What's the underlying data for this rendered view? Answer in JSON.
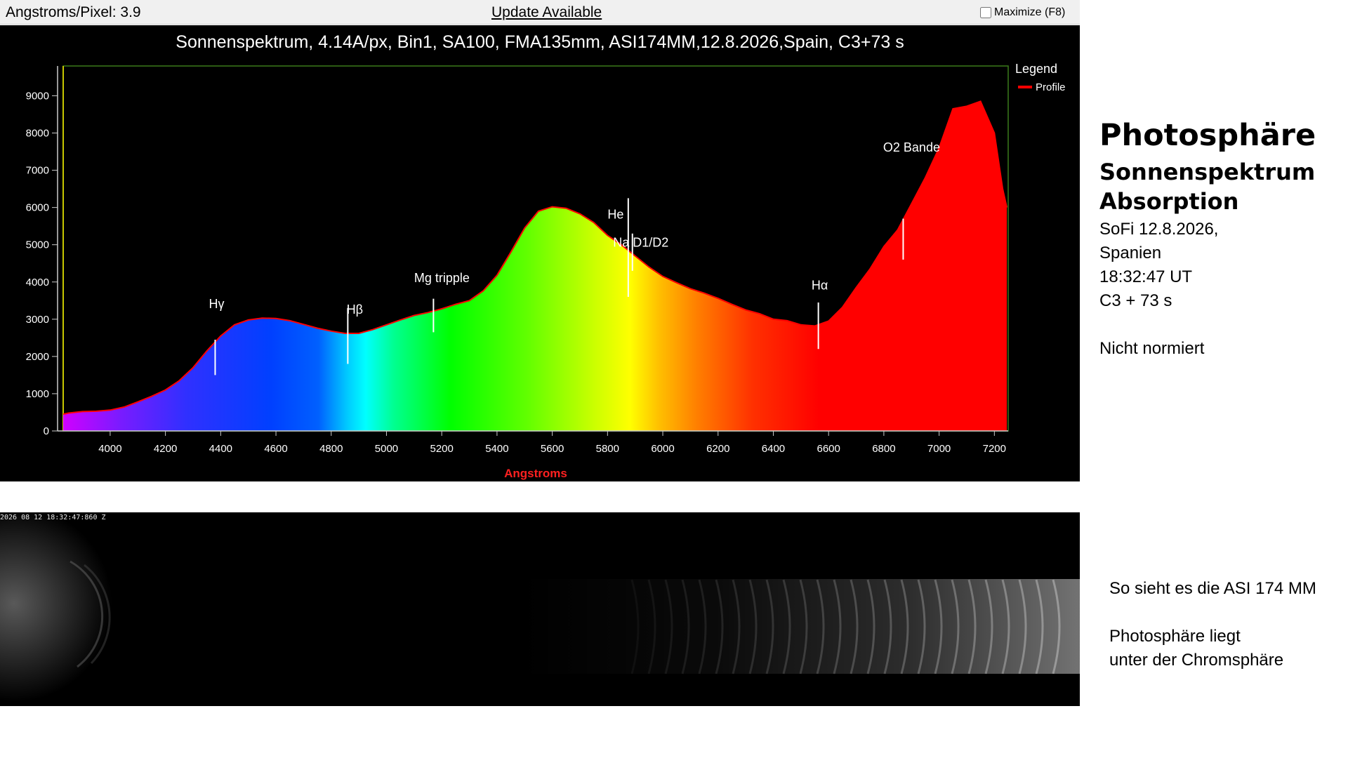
{
  "toolbar": {
    "angstrom_label": "Angstroms/Pixel: 3.9",
    "update_label": "Update Available",
    "maximize_label": "Maximize (F8)"
  },
  "chart_data": {
    "type": "area",
    "title": "Sonnenspektrum, 4.14A/px, Bin1, SA100, FMA135mm, ASI174MM,12.8.2026,Spain, C3+73 s",
    "xlabel": "Angstroms",
    "ylabel": "",
    "xlim": [
      3830,
      7250
    ],
    "ylim": [
      0,
      9800
    ],
    "x_ticks": [
      4000,
      4200,
      4400,
      4600,
      4800,
      5000,
      5200,
      5400,
      5600,
      5800,
      6000,
      6200,
      6400,
      6600,
      6800,
      7000,
      7200
    ],
    "y_ticks": [
      0,
      1000,
      2000,
      3000,
      4000,
      5000,
      6000,
      7000,
      8000,
      9000
    ],
    "legend_title": "Legend",
    "legend_position": "top-right",
    "grid": false,
    "series": [
      {
        "name": "Profile",
        "color": "#ff0000",
        "fill": "spectral-gradient",
        "x": [
          3830,
          3850,
          3900,
          3950,
          4000,
          4050,
          4100,
          4150,
          4200,
          4250,
          4300,
          4350,
          4400,
          4450,
          4500,
          4550,
          4600,
          4650,
          4700,
          4750,
          4800,
          4850,
          4900,
          4950,
          5000,
          5050,
          5100,
          5150,
          5200,
          5250,
          5300,
          5350,
          5400,
          5450,
          5500,
          5550,
          5600,
          5650,
          5700,
          5750,
          5800,
          5850,
          5900,
          5950,
          6000,
          6050,
          6100,
          6150,
          6200,
          6250,
          6300,
          6350,
          6400,
          6450,
          6500,
          6550,
          6600,
          6650,
          6700,
          6750,
          6800,
          6850,
          6900,
          6950,
          7000,
          7050,
          7100,
          7150,
          7200,
          7230,
          7245
        ],
        "values": [
          450,
          480,
          520,
          530,
          560,
          640,
          780,
          930,
          1100,
          1350,
          1700,
          2150,
          2550,
          2850,
          2980,
          3030,
          3020,
          2960,
          2860,
          2760,
          2680,
          2620,
          2620,
          2720,
          2850,
          2980,
          3100,
          3180,
          3280,
          3400,
          3500,
          3760,
          4180,
          4800,
          5450,
          5900,
          6020,
          5980,
          5830,
          5600,
          5250,
          5000,
          4700,
          4400,
          4150,
          3980,
          3820,
          3700,
          3560,
          3400,
          3250,
          3150,
          3000,
          2960,
          2850,
          2820,
          2950,
          3320,
          3850,
          4350,
          4950,
          5400,
          6100,
          6800,
          7600,
          8650,
          8720,
          8850,
          8000,
          6500,
          6000
        ]
      }
    ],
    "annotations": [
      {
        "label": "Hγ",
        "x": 4380,
        "line_y": [
          1500,
          2450
        ],
        "label_y": 3300
      },
      {
        "label": "Hβ",
        "x": 4860,
        "line_y": [
          1800,
          3300
        ],
        "label_y": 3150
      },
      {
        "label": "Mg tripple",
        "x": 5170,
        "line_y": [
          2650,
          3550
        ],
        "label_y": 4000
      },
      {
        "label": "He",
        "x": 5875,
        "line_y": [
          3600,
          6250
        ],
        "label_y": 5700
      },
      {
        "label": "Na D1/D2",
        "x": 5890,
        "line_y": [
          4300,
          5300
        ],
        "label_y": 4950
      },
      {
        "label": "Hα",
        "x": 6563,
        "line_y": [
          2200,
          3450
        ],
        "label_y": 3800
      },
      {
        "label": "O2 Bande",
        "x": 6870,
        "line_y": [
          4600,
          5700
        ],
        "label_y": 7500
      }
    ]
  },
  "camera": {
    "timestamp": "2026 08 12 18:32:47:860 Z"
  },
  "side": {
    "title": "Photosphäre",
    "sub1": "Sonnenspektrum",
    "sub2": "Absorption",
    "lines": [
      "SoFi 12.8.2026,",
      "Spanien",
      "18:32:47 UT",
      "C3 + 73 s",
      "Nicht normiert"
    ]
  },
  "notes": {
    "line1": "So sieht es die ASI 174 MM",
    "line2": "Photosphäre liegt",
    "line3": "unter der Chromsphäre"
  }
}
